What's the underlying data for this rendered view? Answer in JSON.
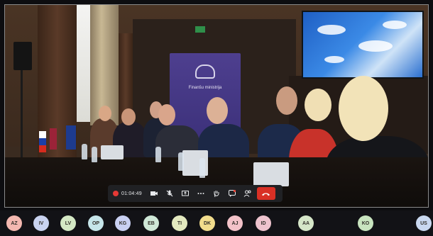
{
  "scene": {
    "banner_text": "Finanšu ministrija"
  },
  "toolbar": {
    "recording_time": "01:04:49",
    "buttons": [
      {
        "name": "camera-button",
        "icon": "camera-icon"
      },
      {
        "name": "mute-button",
        "icon": "mic-off-icon"
      },
      {
        "name": "share-button",
        "icon": "share-screen-icon"
      },
      {
        "name": "more-button",
        "icon": "more-icon"
      },
      {
        "name": "raise-hand-button",
        "icon": "hand-icon"
      },
      {
        "name": "chat-button",
        "icon": "chat-icon"
      },
      {
        "name": "participants-button",
        "icon": "people-icon"
      }
    ],
    "colors": {
      "background": "#202124",
      "record": "#e53935",
      "end_call": "#d93025"
    }
  },
  "participants": [
    {
      "initials": "AZ",
      "color": "#f4b8b0"
    },
    {
      "initials": "IV",
      "color": "#c9d3f0"
    },
    {
      "initials": "LV",
      "color": "#d4e8c4"
    },
    {
      "initials": "OP",
      "color": "#c6e6ea"
    },
    {
      "initials": "KG",
      "color": "#c9d0f2"
    },
    {
      "initials": "EB",
      "color": "#cfe8d7"
    },
    {
      "initials": "TI",
      "color": "#e3e9bf"
    },
    {
      "initials": "DK",
      "color": "#f1dc8c"
    },
    {
      "initials": "AJ",
      "color": "#f3c2c9"
    },
    {
      "initials": "ID",
      "color": "#eec3ce"
    },
    {
      "initials": "AA",
      "color": "#d5e6c8"
    },
    {
      "initials": "KO",
      "color": "#c8e4bf"
    },
    {
      "initials": "US",
      "color": "#c9d8f0"
    }
  ]
}
